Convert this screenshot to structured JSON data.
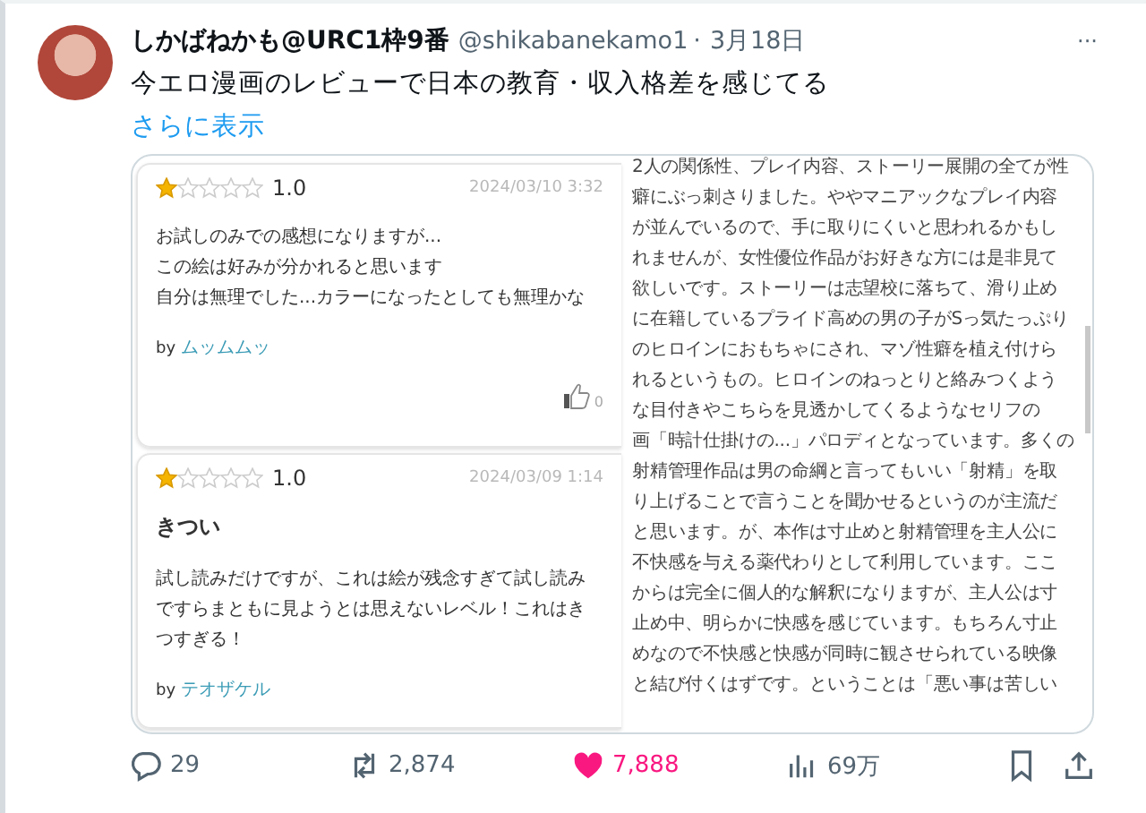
{
  "tweet": {
    "author_name": "しかばねかも@URC1枠9番",
    "handle": "@shikabanekamo1",
    "separator": "·",
    "date": "3月18日",
    "more": "···",
    "text": "今エロ漫画のレビューで日本の教育・収入格差を感じてる",
    "show_more": "さらに表示"
  },
  "image": {
    "reviews": [
      {
        "stars": 1,
        "score": "1.0",
        "date": "2024/03/10 3:32",
        "body": [
          "お試しのみでの感想になりますが...",
          "この絵は好みが分かれると思います",
          "自分は無理でした...カラーになったとしても無理かな"
        ],
        "by": "by",
        "reviewer": "ムッムムッ",
        "likes": "0"
      },
      {
        "stars": 1,
        "score": "1.0",
        "date": "2024/03/09 1:14",
        "title": "きつい",
        "body": [
          "試し読みだけですが、これは絵が残念すぎて試し読み",
          "ですらまともに見ようとは思えないレベル！これはき",
          "つすぎる！"
        ],
        "by": "by",
        "reviewer": "テオザケル"
      }
    ],
    "long_review": [
      "2人の関係性、プレイ内容、ストーリー展開の全てが性",
      "癖にぶっ刺さりました。ややマニアックなプレイ内容",
      "が並んでいるので、手に取りにくいと思われるかもし",
      "れませんが、女性優位作品がお好きな方には是非見て",
      "欲しいです。ストーリーは志望校に落ちて、滑り止め",
      "に在籍しているプライド高めの男の子がSっ気たっぷり",
      "のヒロインにおもちゃにされ、マゾ性癖を植え付けら",
      "れるというもの。ヒロインのねっとりと絡みつくよう",
      "な目付きやこちらを見透かしてくるようなセリフの",
      "画「時計仕掛けの...」パロディとなっています。多くの",
      "射精管理作品は男の命綱と言ってもいい「射精」を取",
      "り上げることで言うことを聞かせるというのが主流だ",
      "と思います。が、本作は寸止めと射精管理を主人公に",
      "不快感を与える薬代わりとして利用しています。ここ",
      "からは完全に個人的な解釈になりますが、主人公は寸",
      "止め中、明らかに快感を感じています。もちろん寸止",
      "めなので不快感と快感が同時に観させられている映像",
      "と結び付くはずです。ということは「悪い事は苦しい"
    ]
  },
  "actions": [
    {
      "kind": "reply",
      "count": "29",
      "selected": false
    },
    {
      "kind": "repost",
      "count": "2,874",
      "selected": false
    },
    {
      "kind": "like",
      "count": "7,888",
      "selected": true
    },
    {
      "kind": "views",
      "count": "69万",
      "selected": false
    },
    {
      "kind": "bookmark",
      "selected": false
    },
    {
      "kind": "share"
    }
  ]
}
